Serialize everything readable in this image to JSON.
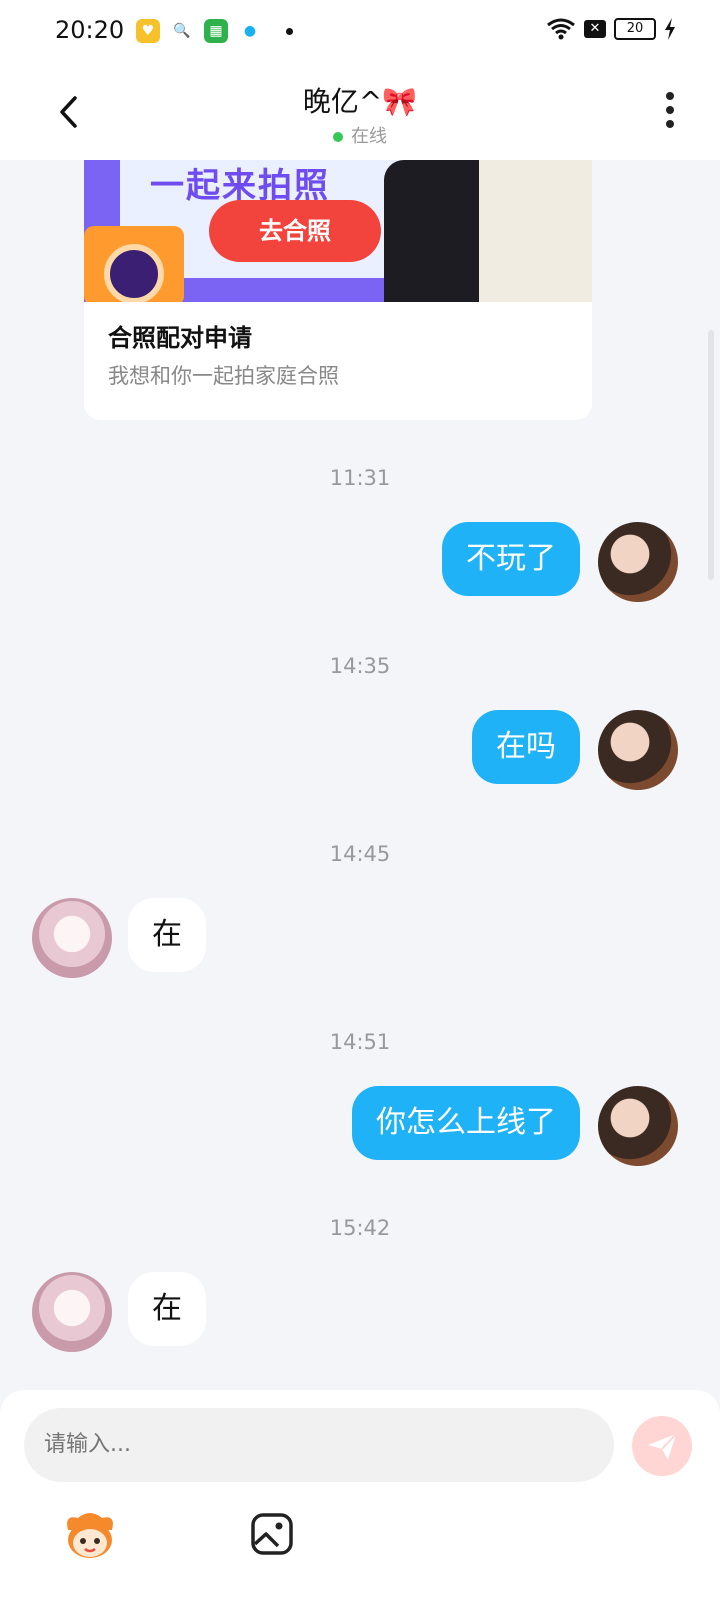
{
  "status_bar": {
    "time": "20:20",
    "battery": "20"
  },
  "header": {
    "title": "晚亿^🎀",
    "status": "在线"
  },
  "card": {
    "button_label": "去合照",
    "banner_text": "一起来拍照",
    "title": "合照配对申请",
    "subtitle": "我想和你一起拍家庭合照"
  },
  "messages": [
    {
      "time": "11:31",
      "side": "me",
      "text": "不玩了"
    },
    {
      "time": "14:35",
      "side": "me",
      "text": "在吗"
    },
    {
      "time": "14:45",
      "side": "other",
      "text": "在"
    },
    {
      "time": "14:51",
      "side": "me",
      "text": "你怎么上线了"
    },
    {
      "time": "15:42",
      "side": "other",
      "text": "在"
    }
  ],
  "composer": {
    "placeholder": "请输入..."
  },
  "icons": [
    "back-icon",
    "more-icon",
    "send-icon",
    "mascot-icon",
    "image-icon"
  ],
  "colors": {
    "my_bubble": "#20b2f6",
    "online_dot": "#34c759",
    "send_button": "#ffd6d3"
  }
}
